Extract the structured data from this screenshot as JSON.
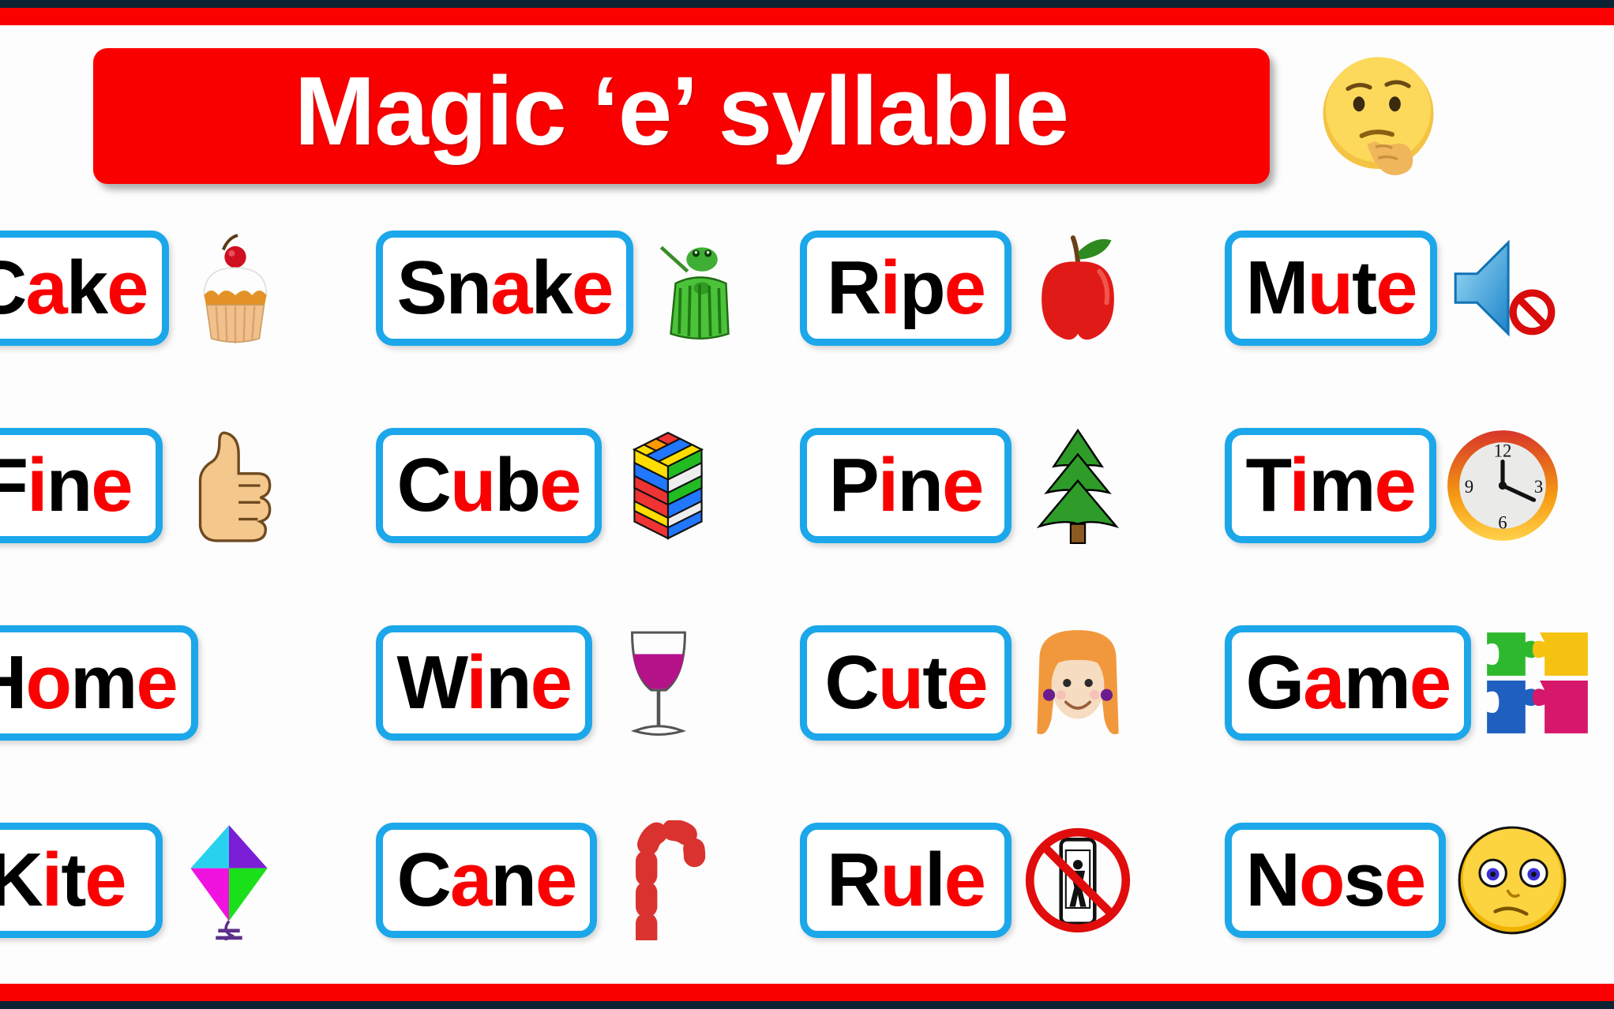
{
  "header": {
    "title": "Magic ‘e’ syllable",
    "emoji_name": "thinking-face-emoji",
    "banner_color": "#fb0000",
    "title_color": "#ffffff"
  },
  "theme": {
    "card_border_color": "#1ba7ea",
    "accent_bar_color": "#fb0000",
    "edge_strip_color": "#0d2233",
    "vowel_color": "#fb0000",
    "consonant_color": "#000000",
    "background_color": "#ffffff"
  },
  "grid": {
    "rows": 4,
    "columns": 4,
    "cells": [
      [
        {
          "word": "Cake",
          "parts": [
            {
              "t": "C",
              "red": false
            },
            {
              "t": "a",
              "red": true
            },
            {
              "t": "k",
              "red": false
            },
            {
              "t": "e",
              "red": true
            }
          ],
          "emoji_name": "cupcake-emoji"
        },
        {
          "word": "Snake",
          "parts": [
            {
              "t": "Sn",
              "red": false
            },
            {
              "t": "a",
              "red": true
            },
            {
              "t": "k",
              "red": false
            },
            {
              "t": "e",
              "red": true
            }
          ],
          "emoji_name": "snake-emoji"
        },
        {
          "word": "Ripe",
          "parts": [
            {
              "t": "R",
              "red": false
            },
            {
              "t": "i",
              "red": true
            },
            {
              "t": "p",
              "red": false
            },
            {
              "t": "e",
              "red": true
            }
          ],
          "emoji_name": "apple-emoji"
        },
        {
          "word": "Mute",
          "parts": [
            {
              "t": "M",
              "red": false
            },
            {
              "t": "u",
              "red": true
            },
            {
              "t": "t",
              "red": false
            },
            {
              "t": "e",
              "red": true
            }
          ],
          "emoji_name": "muted-speaker-emoji"
        }
      ],
      [
        {
          "word": "Fine",
          "parts": [
            {
              "t": "F",
              "red": false
            },
            {
              "t": "i",
              "red": true
            },
            {
              "t": "n",
              "red": false
            },
            {
              "t": "e",
              "red": true
            }
          ],
          "emoji_name": "thumbs-up-emoji"
        },
        {
          "word": "Cube",
          "parts": [
            {
              "t": "C",
              "red": false
            },
            {
              "t": "u",
              "red": true
            },
            {
              "t": "b",
              "red": false
            },
            {
              "t": "e",
              "red": true
            }
          ],
          "emoji_name": "rubiks-cube-emoji"
        },
        {
          "word": "Pine",
          "parts": [
            {
              "t": "P",
              "red": false
            },
            {
              "t": "i",
              "red": true
            },
            {
              "t": "n",
              "red": false
            },
            {
              "t": "e",
              "red": true
            }
          ],
          "emoji_name": "evergreen-tree-emoji"
        },
        {
          "word": "Time",
          "parts": [
            {
              "t": "T",
              "red": false
            },
            {
              "t": "i",
              "red": true
            },
            {
              "t": "m",
              "red": false
            },
            {
              "t": "e",
              "red": true
            }
          ],
          "emoji_name": "clock-emoji"
        }
      ],
      [
        {
          "word": "Home",
          "parts": [
            {
              "t": "H",
              "red": false
            },
            {
              "t": "o",
              "red": true
            },
            {
              "t": "m",
              "red": false
            },
            {
              "t": "e",
              "red": true
            }
          ],
          "emoji_name": "none"
        },
        {
          "word": "Wine",
          "parts": [
            {
              "t": "W",
              "red": false
            },
            {
              "t": "i",
              "red": true
            },
            {
              "t": "n",
              "red": false
            },
            {
              "t": "e",
              "red": true
            }
          ],
          "emoji_name": "wine-glass-emoji"
        },
        {
          "word": "Cute",
          "parts": [
            {
              "t": "C",
              "red": false
            },
            {
              "t": "u",
              "red": true
            },
            {
              "t": "t",
              "red": false
            },
            {
              "t": "e",
              "red": true
            }
          ],
          "emoji_name": "girl-face-emoji"
        },
        {
          "word": "Game",
          "parts": [
            {
              "t": "G",
              "red": false
            },
            {
              "t": "a",
              "red": true
            },
            {
              "t": "m",
              "red": false
            },
            {
              "t": "e",
              "red": true
            }
          ],
          "emoji_name": "puzzle-piece-emoji"
        }
      ],
      [
        {
          "word": "Kite",
          "parts": [
            {
              "t": "K",
              "red": false
            },
            {
              "t": "i",
              "red": true
            },
            {
              "t": "t",
              "red": false
            },
            {
              "t": "e",
              "red": true
            }
          ],
          "emoji_name": "kite-emoji"
        },
        {
          "word": "Cane",
          "parts": [
            {
              "t": "C",
              "red": false
            },
            {
              "t": "a",
              "red": true
            },
            {
              "t": "n",
              "red": false
            },
            {
              "t": "e",
              "red": true
            }
          ],
          "emoji_name": "candy-cane-emoji"
        },
        {
          "word": "Rule",
          "parts": [
            {
              "t": "R",
              "red": false
            },
            {
              "t": "u",
              "red": true
            },
            {
              "t": "l",
              "red": false
            },
            {
              "t": "e",
              "red": true
            }
          ],
          "emoji_name": "no-mobile-phones-emoji"
        },
        {
          "word": "Nose",
          "parts": [
            {
              "t": "N",
              "red": false
            },
            {
              "t": "o",
              "red": true
            },
            {
              "t": "s",
              "red": false
            },
            {
              "t": "e",
              "red": true
            }
          ],
          "emoji_name": "woozy-face-emoji"
        }
      ]
    ]
  }
}
